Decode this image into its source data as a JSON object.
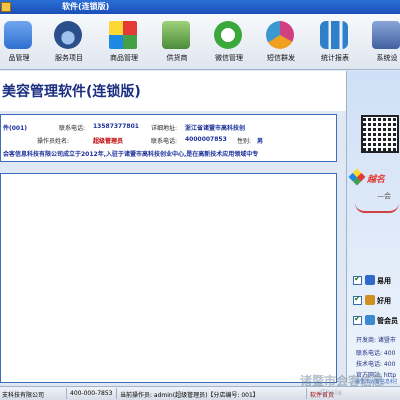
{
  "window": {
    "title": "软件(连锁版)"
  },
  "toolbar": {
    "items": [
      {
        "label": "品管理",
        "icon": "member-card-icon",
        "color": "#2f6fd0"
      },
      {
        "label": "服务项目",
        "icon": "gauge-icon",
        "color": "#2b4f8a"
      },
      {
        "label": "商品管理",
        "icon": "grid-icon",
        "color": "#e0a020"
      },
      {
        "label": "供货商",
        "icon": "truck-icon",
        "color": "#4a8c3a"
      },
      {
        "label": "微信管理",
        "icon": "wechat-icon",
        "color": "#3aa83a"
      },
      {
        "label": "短信群发",
        "icon": "sms-icon",
        "color": "#d04080"
      },
      {
        "label": "统计报表",
        "icon": "chart-icon",
        "color": "#2f80c8"
      },
      {
        "label": "系统设",
        "icon": "settings-icon",
        "color": "#4060a0"
      }
    ]
  },
  "header": {
    "app_title": "美容管理软件(连锁版)"
  },
  "info": {
    "row1": {
      "store_id": "件(001)",
      "phone_label": "联系电话:",
      "phone": "13587377801",
      "address_label": "详细地址:",
      "address": "浙江省诸暨市高科技创"
    },
    "row2": {
      "operator_label": "操作员姓名:",
      "operator": "超级管理员",
      "phone_label": "联系电话:",
      "phone": "4000007853",
      "gender_label": "性别:",
      "gender": "男"
    },
    "row3": {
      "intro": "会客信息科技有限公司成立于2012年,入驻于诸暨市高科技创业中心,是在高新技术应用领域中专"
    }
  },
  "right_panel": {
    "logo_text": "越名",
    "dash_text": "—会",
    "checks": [
      {
        "label": "易用"
      },
      {
        "label": "好用"
      },
      {
        "label": "管会员"
      }
    ],
    "dev_lines": [
      "开发商: 诸暨市",
      "联系电话: 400",
      "技术电话: 400",
      "官方网站: http"
    ],
    "blue_line": "诸暨市会客信息科技"
  },
  "status": {
    "company": "支科技有限公司",
    "phone": "400-000-7853",
    "operator": "当前操作员: admin(超级管理员)【分店编号: 001】",
    "home_link": "软件首页"
  },
  "watermark": {
    "line1": "诸暨市会客信息",
    "line2": "Chsia"
  }
}
